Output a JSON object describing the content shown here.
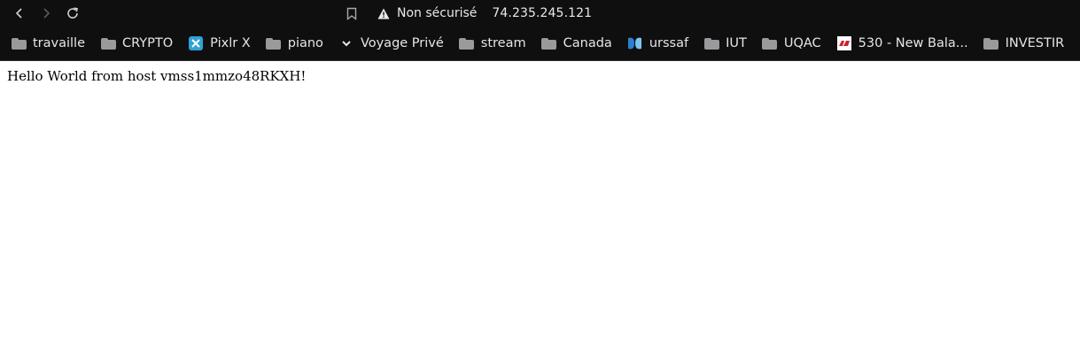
{
  "browser": {
    "security_label": "Non sécurisé",
    "url": "74.235.245.121",
    "icons": {
      "back": "back-arrow-icon",
      "forward": "forward-arrow-icon",
      "reload": "reload-icon",
      "bookmark": "bookmark-icon",
      "security": "warning-icon"
    }
  },
  "bookmarks": [
    {
      "label": "travaille",
      "icon": "folder-icon"
    },
    {
      "label": "CRYPTO",
      "icon": "folder-icon"
    },
    {
      "label": "Pixlr X",
      "icon": "pixlr-icon"
    },
    {
      "label": "piano",
      "icon": "folder-icon"
    },
    {
      "label": "Voyage Privé",
      "icon": "chevron-icon"
    },
    {
      "label": "stream",
      "icon": "folder-icon"
    },
    {
      "label": "Canada",
      "icon": "folder-icon"
    },
    {
      "label": "urssaf",
      "icon": "urssaf-icon"
    },
    {
      "label": "IUT",
      "icon": "folder-icon"
    },
    {
      "label": "UQAC",
      "icon": "folder-icon"
    },
    {
      "label": "530 - New Bala...",
      "icon": "new-balance-icon"
    },
    {
      "label": "INVESTIR",
      "icon": "folder-icon"
    }
  ],
  "page": {
    "text": "Hello World from host vmss1mmzo48RKXH!"
  }
}
